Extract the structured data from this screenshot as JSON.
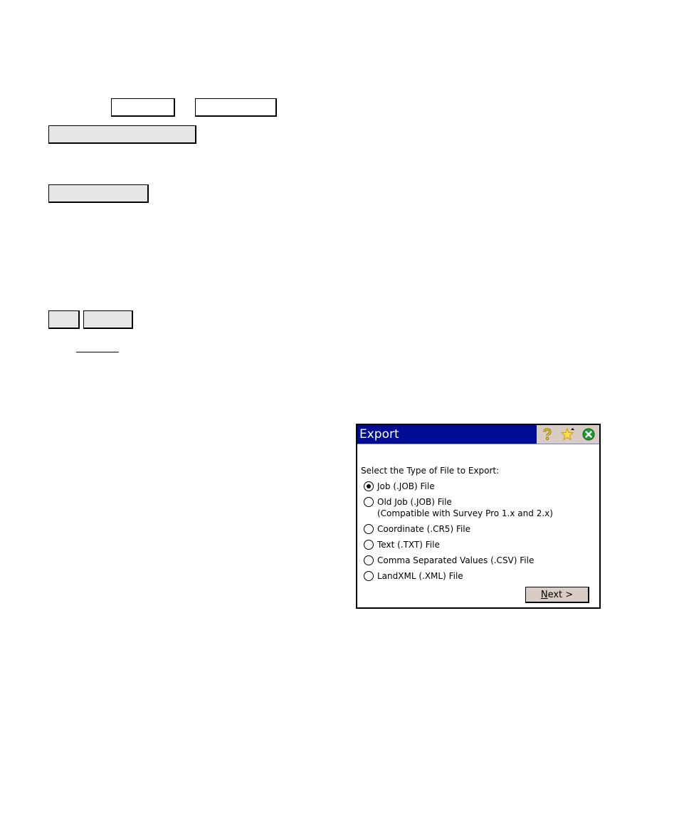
{
  "dialog": {
    "title": "Export",
    "title_icons": [
      {
        "name": "help-icon",
        "glyph": "?"
      },
      {
        "name": "favorites-star-icon",
        "glyph": "★"
      },
      {
        "name": "close-icon",
        "glyph": "✕"
      }
    ],
    "colors": {
      "titlebar": "#000c96",
      "title_icon_area": "#d8ccc4",
      "close_icon": "#1c9a2c",
      "button_face": "#d8ccc4"
    },
    "prompt": "Select the Type of File to Export:",
    "options": [
      {
        "label": "Job (.JOB) File",
        "checked": true
      },
      {
        "label": "Old Job (.JOB) File",
        "sublabel": "(Compatible with Survey Pro 1.x and 2.x)",
        "checked": false
      },
      {
        "label": "Coordinate (.CR5) File",
        "checked": false
      },
      {
        "label": "Text (.TXT) File",
        "checked": false
      },
      {
        "label": "Comma Separated Values (.CSV) File",
        "checked": false
      },
      {
        "label": "LandXML (.XML) File",
        "checked": false
      }
    ],
    "next_button": {
      "mnemonic": "N",
      "rest": "ext >"
    }
  }
}
